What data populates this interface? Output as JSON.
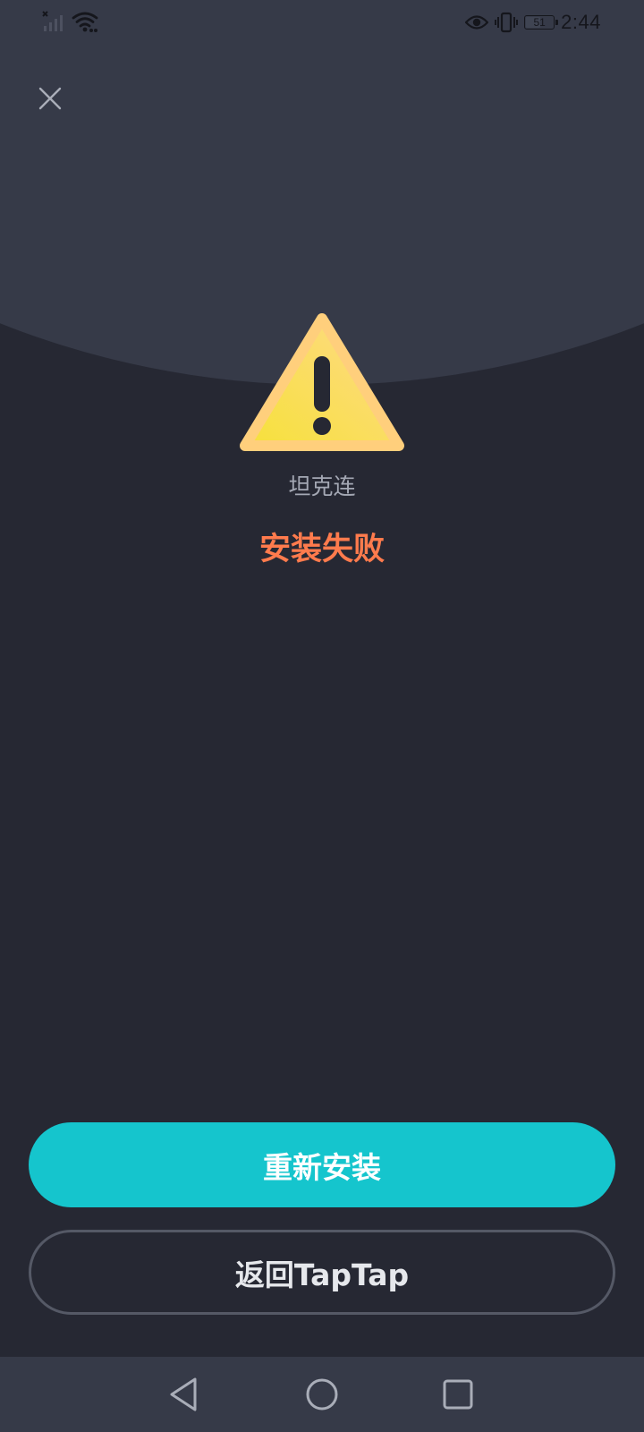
{
  "status_bar": {
    "time": "2:44",
    "battery_level": "51",
    "battery_fraction": 0.51,
    "icons": [
      "signal-off-icon",
      "wifi-icon",
      "eye-comfort-icon",
      "vibrate-icon",
      "battery-icon"
    ]
  },
  "header": {
    "close_icon": "close-icon"
  },
  "app": {
    "name": "坦克连",
    "status": "安装失败",
    "status_color": "#ff7b4d",
    "status_icon": "warning-icon"
  },
  "actions": {
    "reinstall_label": "重新安装",
    "reinstall_color": "#15c5cd",
    "back_label": "返回TapTap"
  },
  "nav_bar": {
    "icons": [
      "back-icon",
      "home-icon",
      "recents-icon"
    ]
  }
}
